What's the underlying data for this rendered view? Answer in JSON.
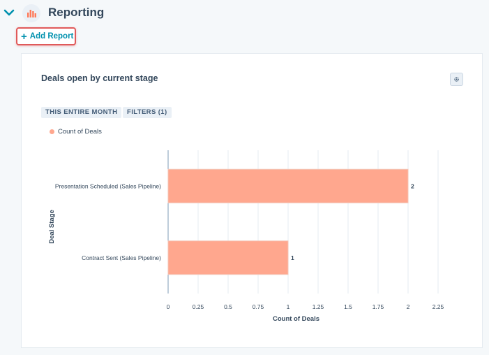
{
  "header": {
    "title": "Reporting",
    "chevron_icon": "chevron-down-icon",
    "section_icon": "bar-chart-icon",
    "accent_color": "#0091ae",
    "icon_color": "#ff7a59"
  },
  "toolbar": {
    "add_report_plus": "+",
    "add_report_label": "Add Report",
    "highlight_color": "#e05a5a"
  },
  "card": {
    "title": "Deals open by current stage",
    "settings_icon": "gear-icon",
    "filters": [
      {
        "label": "THIS ENTIRE MONTH"
      },
      {
        "label": "FILTERS (1)"
      }
    ]
  },
  "chart_data": {
    "type": "bar",
    "orientation": "horizontal",
    "categories": [
      "Presentation Scheduled (Sales Pipeline)",
      "Contract Sent (Sales Pipeline)"
    ],
    "series": [
      {
        "name": "Count of Deals",
        "values": [
          2,
          1
        ],
        "color": "#ffa78e"
      }
    ],
    "data_labels": [
      "2",
      "1"
    ],
    "xlabel": "Count of Deals",
    "ylabel": "Deal Stage",
    "xlim": [
      0,
      2.25
    ],
    "xticks": [
      "0",
      "0.25",
      "0.5",
      "0.75",
      "1",
      "1.25",
      "1.5",
      "1.75",
      "2",
      "2.25"
    ],
    "grid": true,
    "legend": "top-left"
  }
}
